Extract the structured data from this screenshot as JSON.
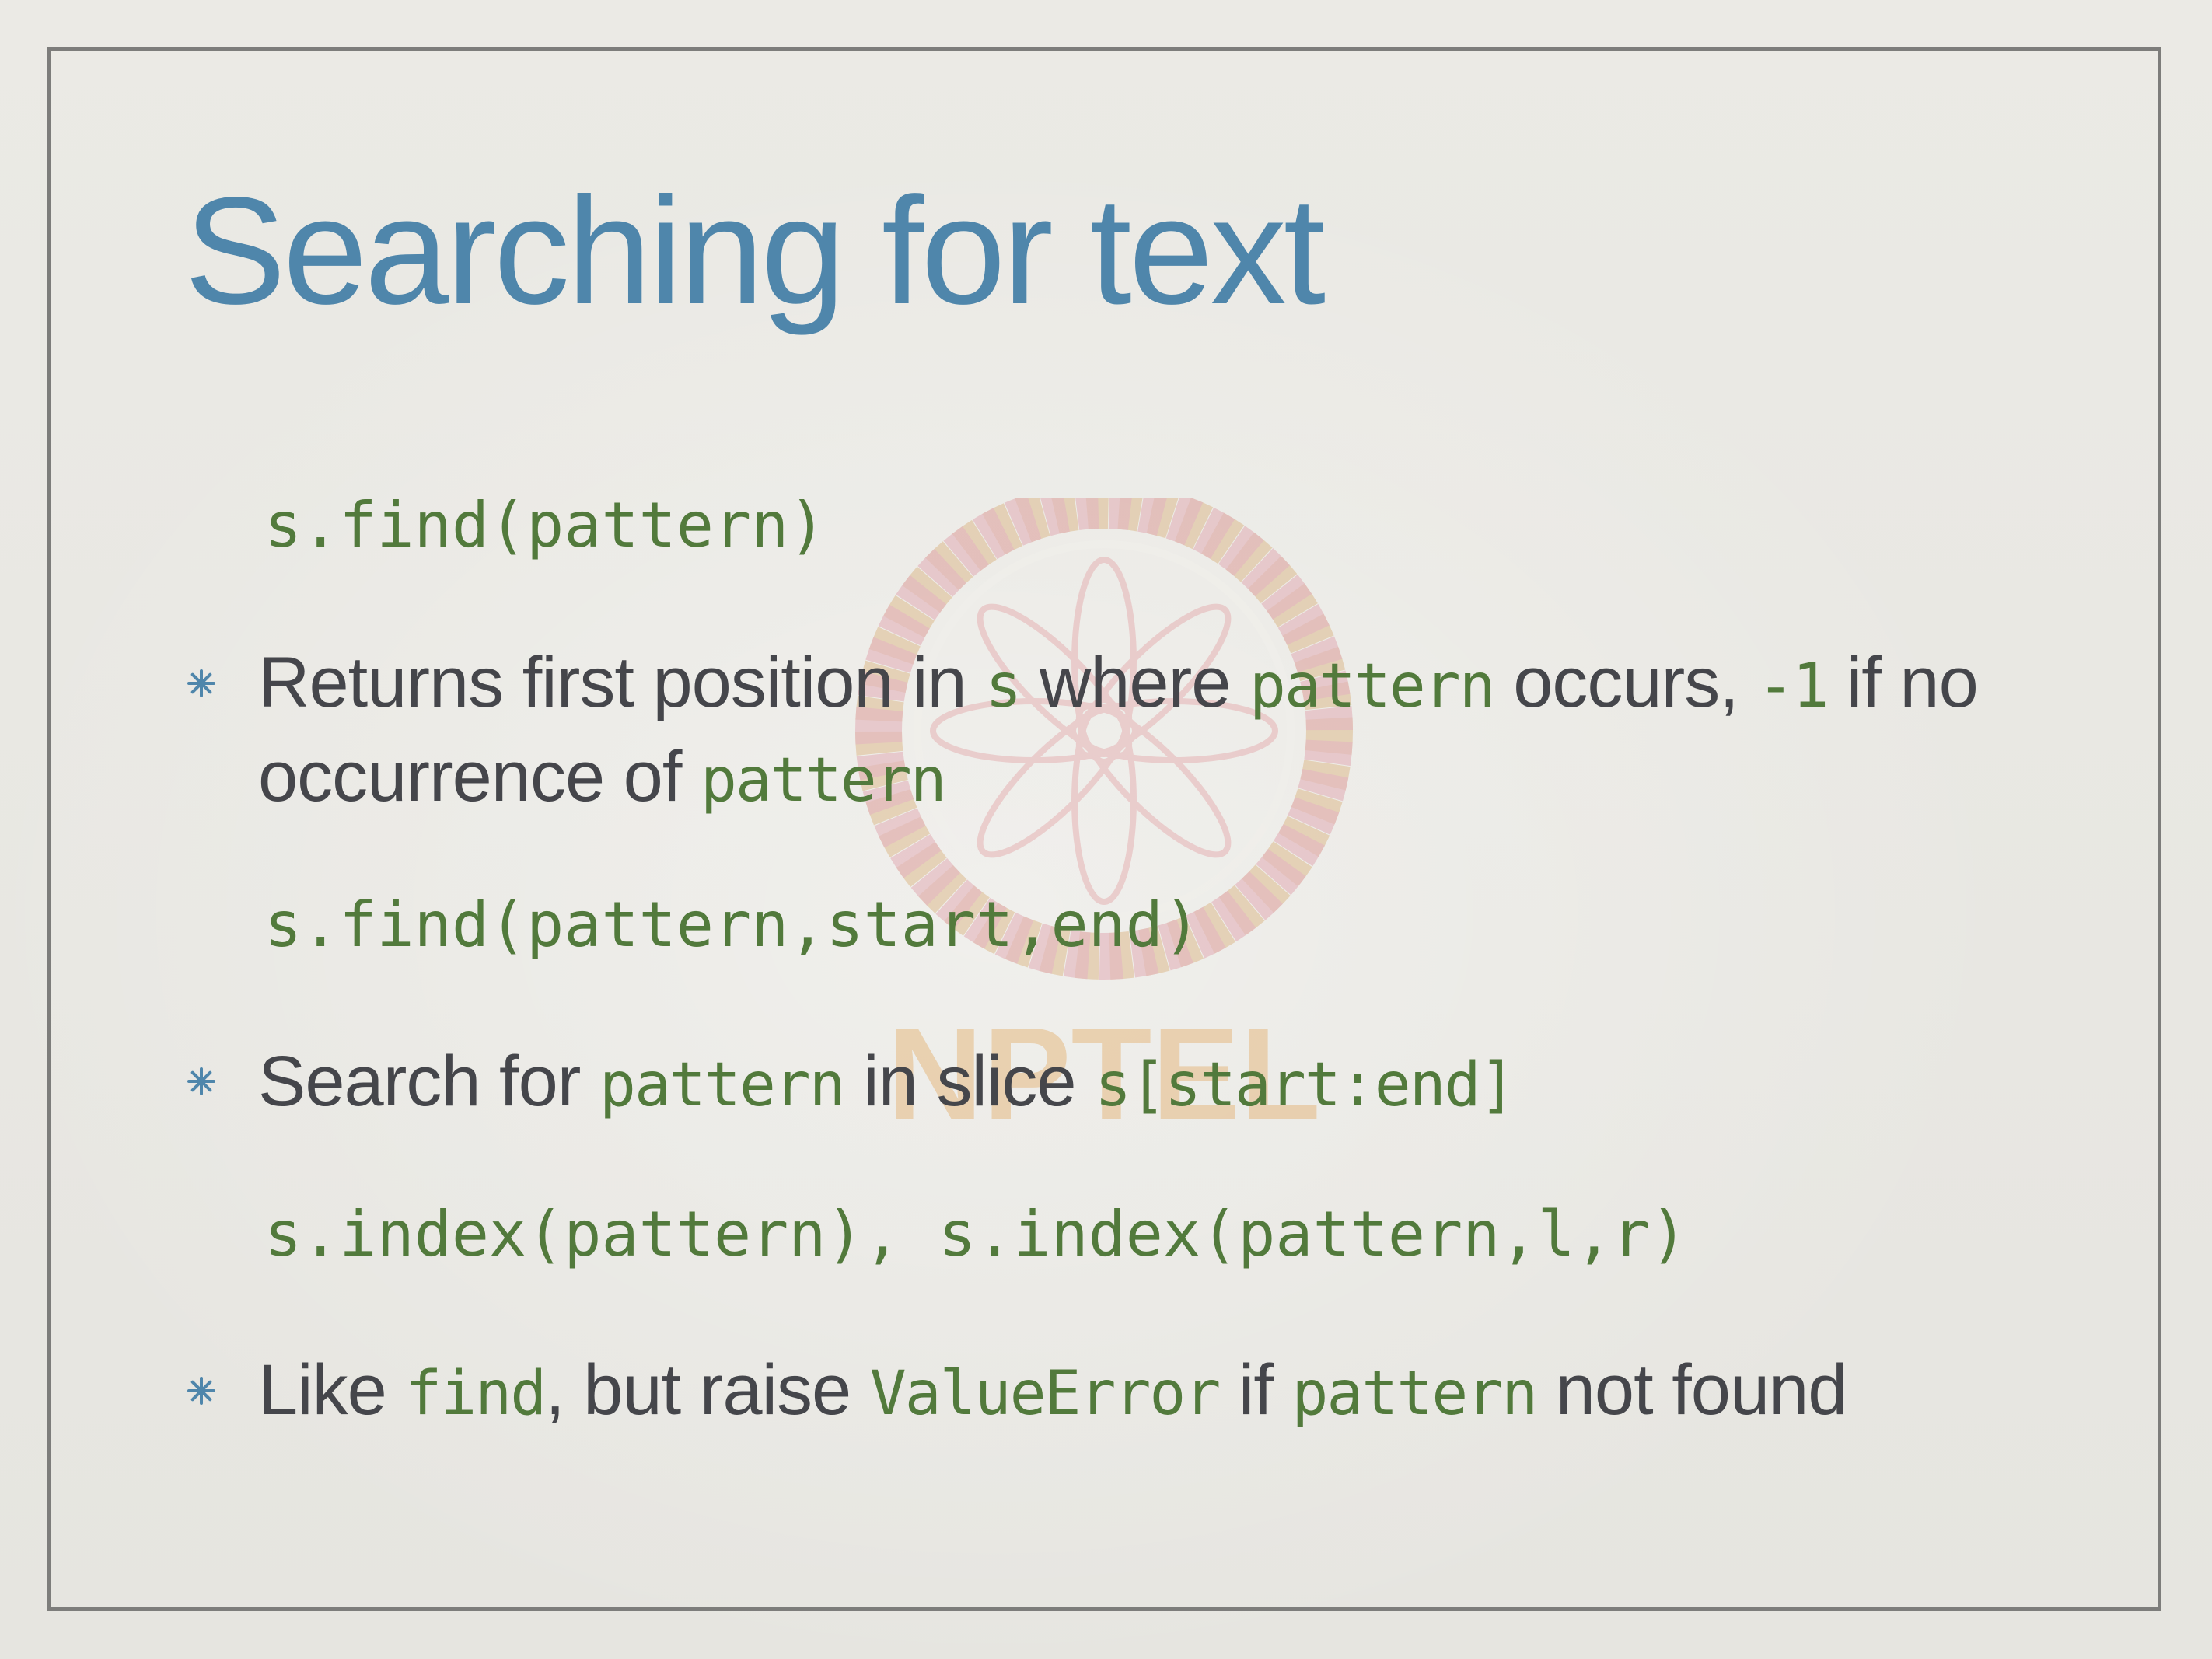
{
  "slide": {
    "title": "Searching for text",
    "code1": "s.find(pattern)",
    "code2": "s.find(pattern,start,end)",
    "code3": "s.index(pattern), s.index(pattern,l,r)",
    "bullet1": {
      "t1": "Returns first position in ",
      "c1": "s",
      "t2": " where ",
      "c2": "pattern",
      "t3": " occurs, ",
      "c3": "-1",
      "t4": " if no occurrence of ",
      "c4": "pattern"
    },
    "bullet2": {
      "t1": "Search for ",
      "c1": "pattern",
      "t2": " in slice ",
      "c2": "s[start:end]"
    },
    "bullet3": {
      "t1": "Like ",
      "c1": "find",
      "t2": ", but raise ",
      "c2": "ValueError",
      "t3": " if ",
      "c3": "pattern",
      "t4": " not found"
    },
    "watermark_text": "NPTEL",
    "colors": {
      "title": "#4f86ab",
      "code": "#527a3c",
      "body": "#45464b",
      "bullet": "#4f86ab"
    }
  }
}
